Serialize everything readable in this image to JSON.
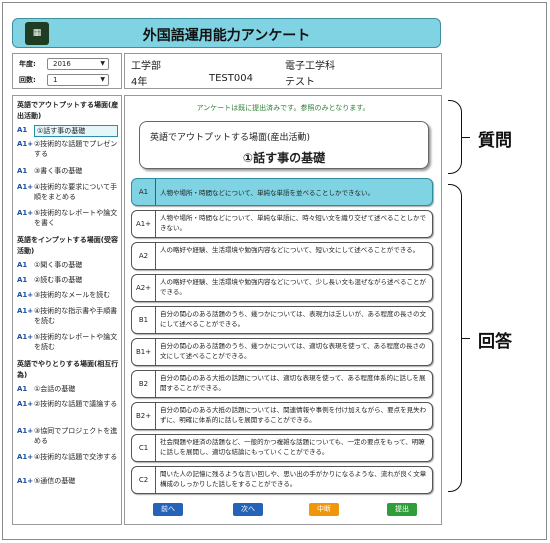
{
  "title": "外国語運用能力アンケート",
  "logo_text": "▦",
  "selector": {
    "year_label": "年度:",
    "year_value": "2016",
    "count_label": "回数:",
    "count_value": "1"
  },
  "info": {
    "faculty": "工学部",
    "department": "電子工学科",
    "grade": "4年",
    "user_id": "TEST004",
    "user_name": "テスト"
  },
  "sidebar": {
    "sections": [
      {
        "heading": "英語でアウトプットする場面(産出活動)",
        "items": [
          {
            "level": "A1",
            "label": "①話す事の基礎"
          },
          {
            "level": "A1+",
            "label": "②技術的な話題でプレゼンする"
          },
          {
            "level": "A1",
            "label": "③書く事の基礎"
          },
          {
            "level": "A1+",
            "label": "④技術的な要求について手順をまとめる"
          },
          {
            "level": "A1+",
            "label": "⑤技術的なレポートや論文を書く"
          }
        ]
      },
      {
        "heading": "英語をインプットする場面(受容活動)",
        "items": [
          {
            "level": "A1",
            "label": "①聞く事の基礎"
          },
          {
            "level": "A1",
            "label": "②読む事の基礎"
          },
          {
            "level": "A1+",
            "label": "③技術的なメールを読む"
          },
          {
            "level": "A1+",
            "label": "④技術的な指示書や手順書を読む"
          },
          {
            "level": "A1+",
            "label": "⑤技術的なレポートや論文を読む"
          }
        ]
      },
      {
        "heading": "英語でやりとりする場面(相互行為)",
        "items": [
          {
            "level": "A1",
            "label": "①会話の基礎"
          },
          {
            "level": "A1+",
            "label": "②技術的な話題で議論する"
          },
          {
            "level": "A1+",
            "label": "③協同でプロジェクトを進める"
          },
          {
            "level": "A1+",
            "label": "④技術的な話題で交渉する"
          },
          {
            "level": "A1+",
            "label": "⑤通信の基礎"
          }
        ]
      }
    ]
  },
  "main": {
    "notice": "アンケートは既に提出済みです。参照のみとなります。",
    "question_scene": "英語でアウトプットする場面(産出活動)",
    "question_title": "①話す事の基礎",
    "answers": [
      {
        "code": "A1",
        "text": "人物や場所・時間などについて、単純な単語を並べることしかできない。"
      },
      {
        "code": "A1+",
        "text": "人物や場所・時間などについて、単純な単語に、時々短い文を織り交ぜて述べることしかできない。"
      },
      {
        "code": "A2",
        "text": "人の略好や経験、生活環境や勉強内容などについて、短い文にして述べることができる。"
      },
      {
        "code": "A2+",
        "text": "人の略好や経験、生活環境や勉強内容などについて、少し長い文も混ぜながら述べることができる。"
      },
      {
        "code": "B1",
        "text": "自分の関心のある話題のうち、幾つかについては、表現力は乏しいが、ある程度の長さの文にして述べることができる。"
      },
      {
        "code": "B1+",
        "text": "自分の関心のある話題のうち、幾つかについては、適切な表現を使って、ある程度の長さの文にして述べることができる。"
      },
      {
        "code": "B2",
        "text": "自分の関心のある大抵の話題については、適切な表現を使って、ある程度体系的に話しを展開することができる。"
      },
      {
        "code": "B2+",
        "text": "自分の関心のある大抵の話題については、関連情報や事例を付け加えながら、要点を見失わずに、明確に体系的に話しを展開することができる。"
      },
      {
        "code": "C1",
        "text": "社会問題や経済の話題など、一般的かつ複雑な話題についても、一定の要点をもって、明瞭に話しを展開し、適切な結論にもっていくことができる。"
      },
      {
        "code": "C2",
        "text": "聞いた人の記憶に残るような言い回しや、思い出の手がかりになるような、流れが良く文章構成のしっかりした話しをすることができる。"
      }
    ]
  },
  "buttons": {
    "prev": "前へ",
    "next": "次へ",
    "suspend": "中断",
    "submit": "提出"
  },
  "annotations": {
    "question": "質問",
    "answer": "回答"
  },
  "colors": {
    "title_bar": "#7fd3e3",
    "selected_answer": "#7fd3e3",
    "notice": "#2e7d32",
    "prev_button": "#2563b8",
    "next_button": "#2563b8",
    "suspend_button": "#f0960c",
    "submit_button": "#2f9e3a"
  }
}
